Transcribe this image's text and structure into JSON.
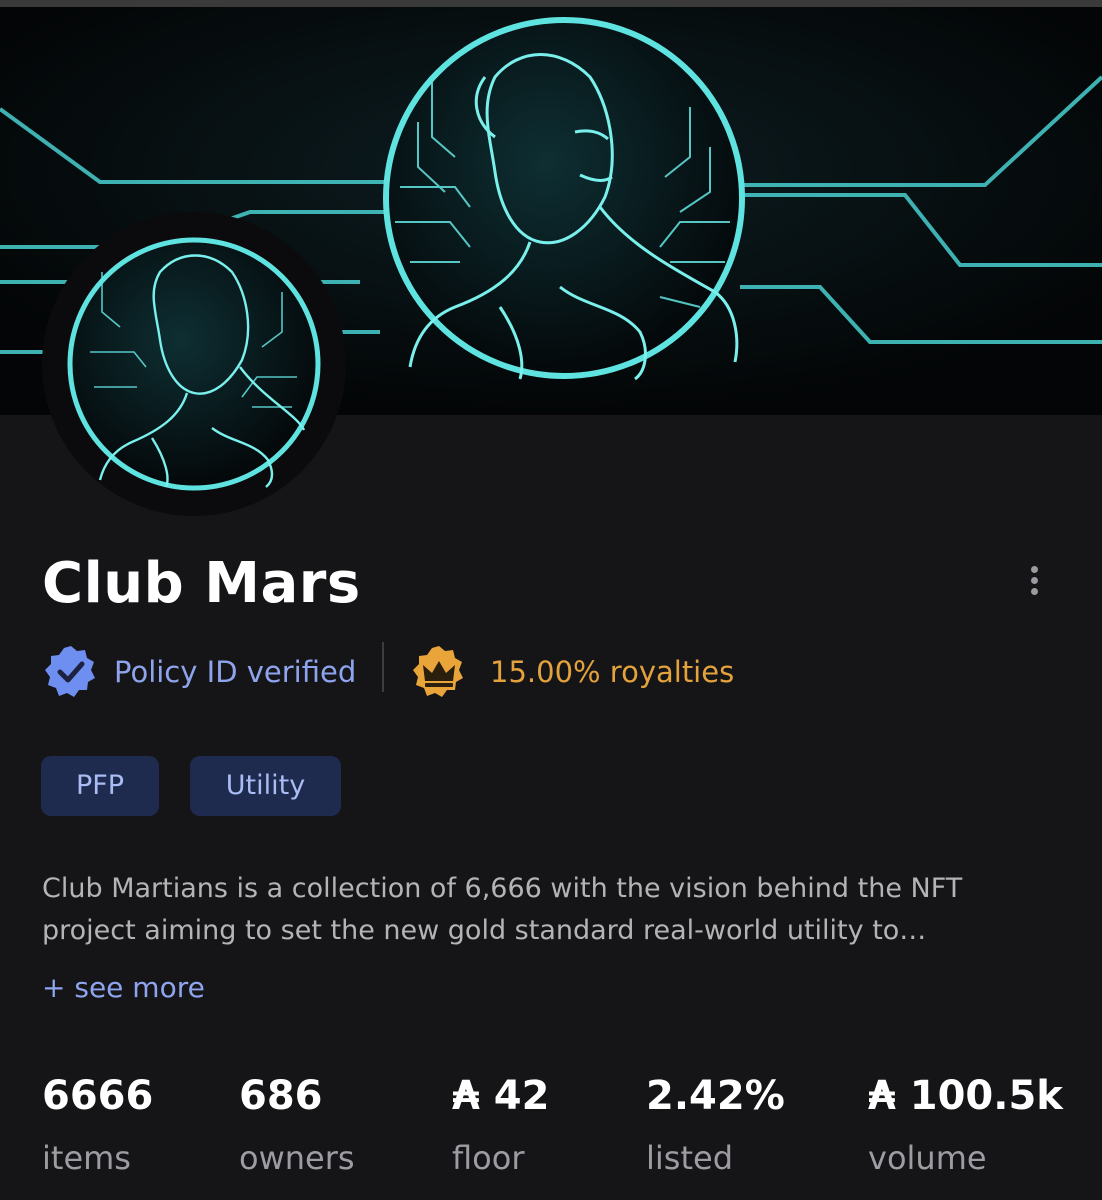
{
  "collection": {
    "name": "Club Mars",
    "verified_label": "Policy ID verified",
    "royalties_label": "15.00% royalties",
    "tags": [
      "PFP",
      "Utility"
    ],
    "description_lines": [
      "Club Martians is a collection of 6,666 with the vision behind the NFT",
      "project aiming to set the new gold standard real-world utility to…"
    ],
    "see_more": "+ see more"
  },
  "stats": [
    {
      "value": "6666",
      "label": "items"
    },
    {
      "value": "686",
      "label": "owners"
    },
    {
      "value": "₳ 42",
      "label": "floor"
    },
    {
      "value": "2.42%",
      "label": "listed"
    },
    {
      "value": "₳ 100.5k",
      "label": "volume"
    }
  ],
  "icons": {
    "verified": "verified-badge-icon",
    "royalties": "crown-icon",
    "menu": "more-vertical-icon"
  },
  "colors": {
    "background": "#151517",
    "accent_blue": "#8ea4ee",
    "royalty_gold": "#e3a23c",
    "tag_bg": "#1e2a4e",
    "neon_cyan": "#5fe3e0"
  }
}
